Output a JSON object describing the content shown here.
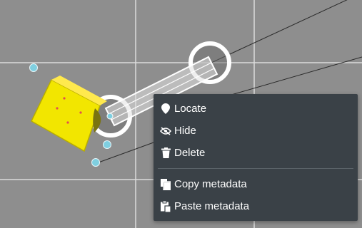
{
  "scene": {
    "background": "#8e8e8e",
    "grid_color": "#d9d9d9",
    "model_color": "#f2e600",
    "handle_color": "#7fcfe0"
  },
  "context_menu": {
    "items": [
      {
        "label": "Locate",
        "icon": "location-pin-icon"
      },
      {
        "label": "Hide",
        "icon": "eye-slash-icon"
      },
      {
        "label": "Delete",
        "icon": "trash-icon"
      },
      {
        "label": "Copy metadata",
        "icon": "copy-icon"
      },
      {
        "label": "Paste metadata",
        "icon": "paste-icon"
      }
    ]
  }
}
